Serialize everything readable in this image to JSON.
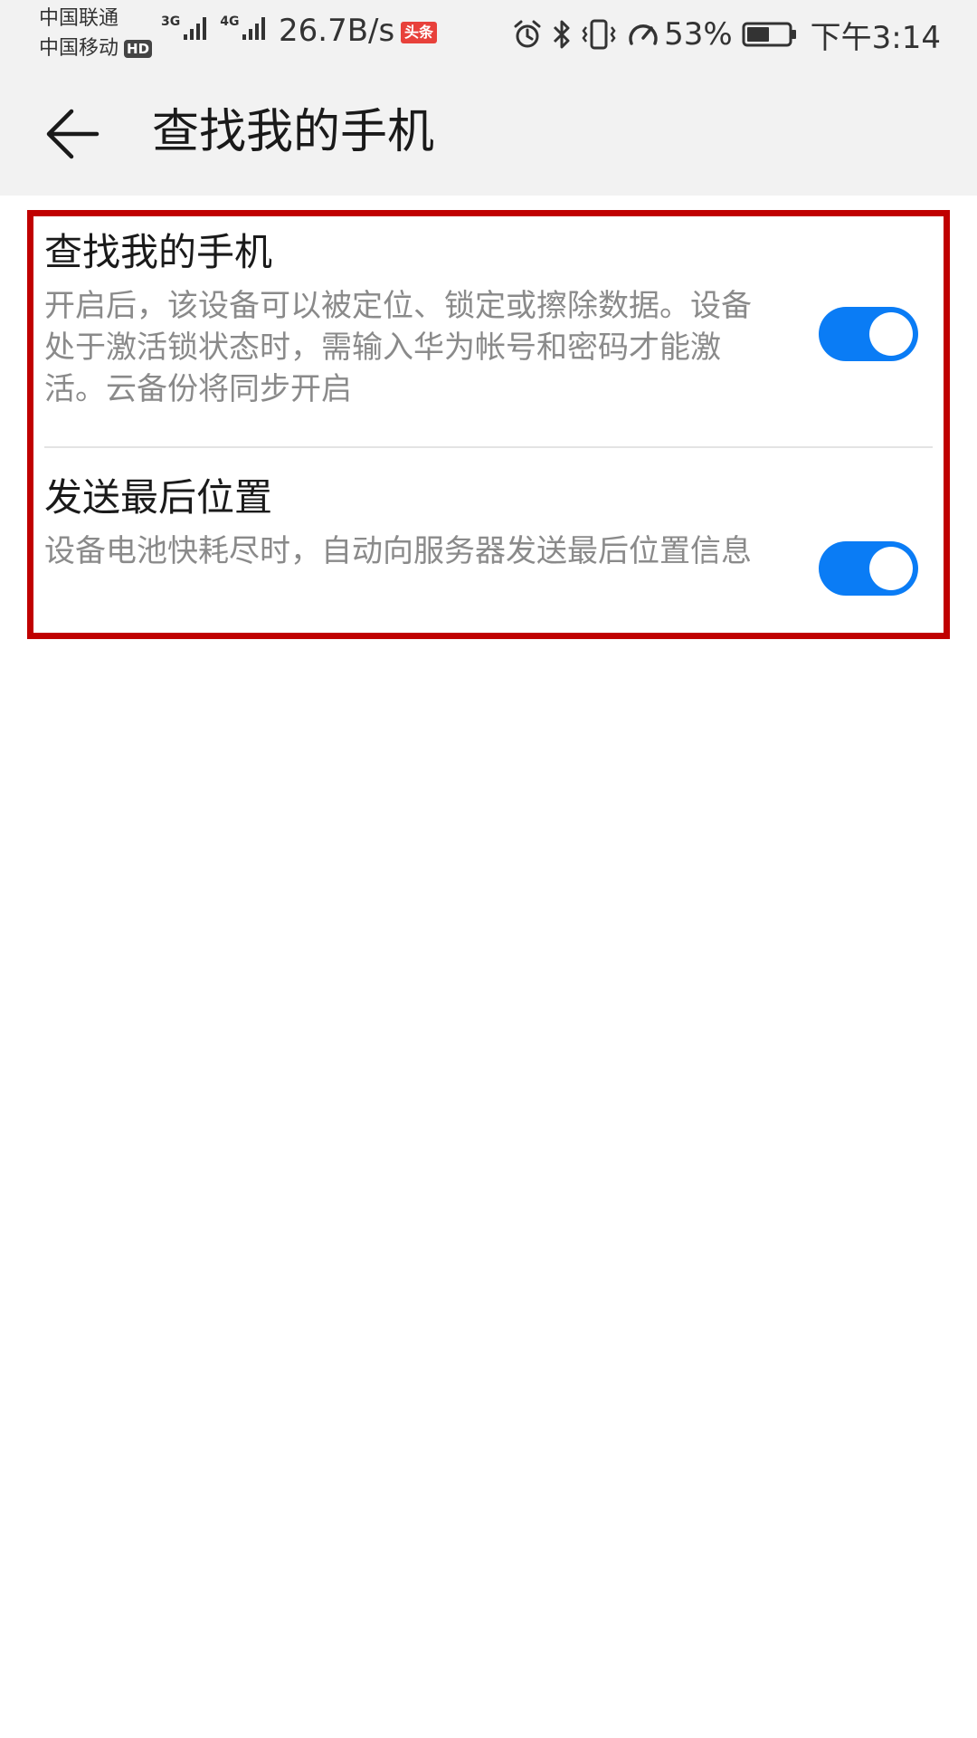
{
  "status_bar": {
    "carrier_1": "中国联通",
    "carrier_2": "中国移动",
    "hd_badge": "HD",
    "net_type_1": "3G",
    "net_type_2": "4G",
    "speed": "26.7B/s",
    "news_badge": "头条",
    "battery_percent": "53%",
    "time": "下午3:14",
    "icons": [
      "alarm-icon",
      "bluetooth-icon",
      "vibrate-icon",
      "speed-boost-icon",
      "battery-icon"
    ]
  },
  "app_bar": {
    "title": "查找我的手机",
    "back_icon": "arrow-left-icon"
  },
  "settings": [
    {
      "title": "查找我的手机",
      "description": "开启后，该设备可以被定位、锁定或擦除数据。设备处于激活锁状态时，需输入华为帐号和密码才能激活。云备份将同步开启",
      "enabled": true
    },
    {
      "title": "发送最后位置",
      "description": "设备电池快耗尽时，自动向服务器发送最后位置信息",
      "enabled": true
    }
  ],
  "colors": {
    "accent": "#0a7cf5",
    "highlight_border": "#c00000",
    "header_bg": "#f2f2f2",
    "description_text": "#8a8a8a"
  }
}
